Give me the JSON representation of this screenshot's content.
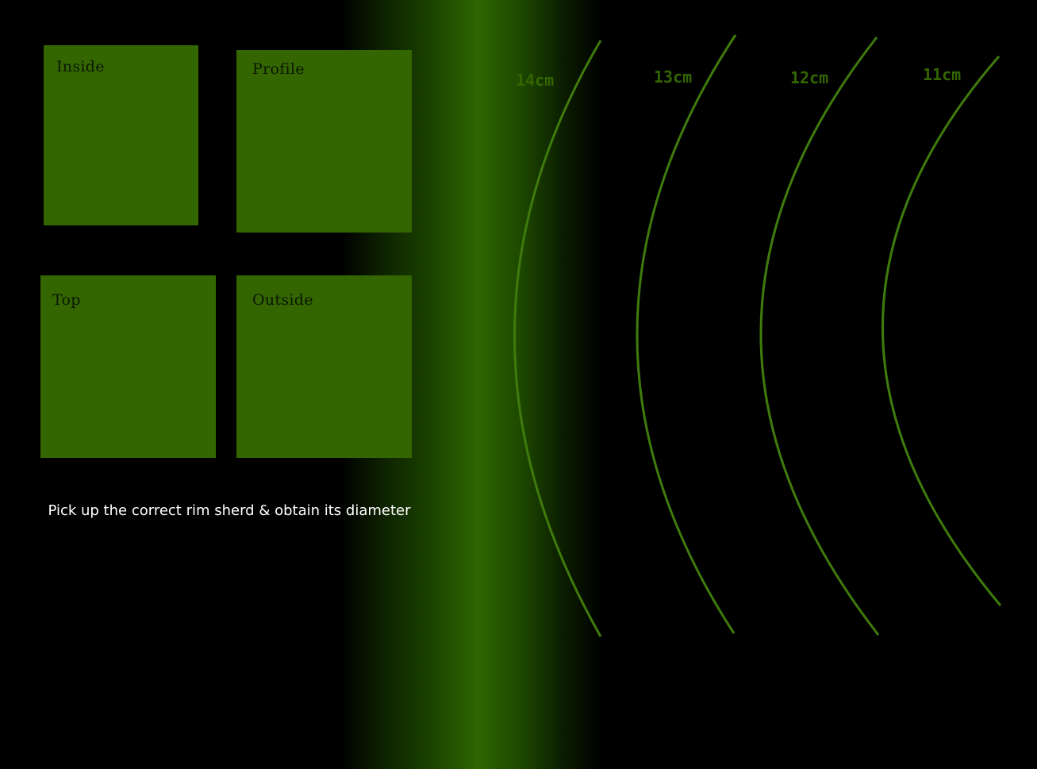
{
  "views": {
    "inside": "Inside",
    "profile": "Profile",
    "top": "Top",
    "outside": "Outside"
  },
  "instruction": "Pick up the correct rim sherd & obtain its diameter",
  "diameter_arcs": [
    {
      "label": "14cm"
    },
    {
      "label": "13cm"
    },
    {
      "label": "12cm"
    },
    {
      "label": "11cm"
    }
  ],
  "colors": {
    "panel": "#336600",
    "arc_stroke": "#3f7a0c",
    "arc_label": "#336600",
    "background": "#000000",
    "instruction_text": "#ffffff"
  }
}
